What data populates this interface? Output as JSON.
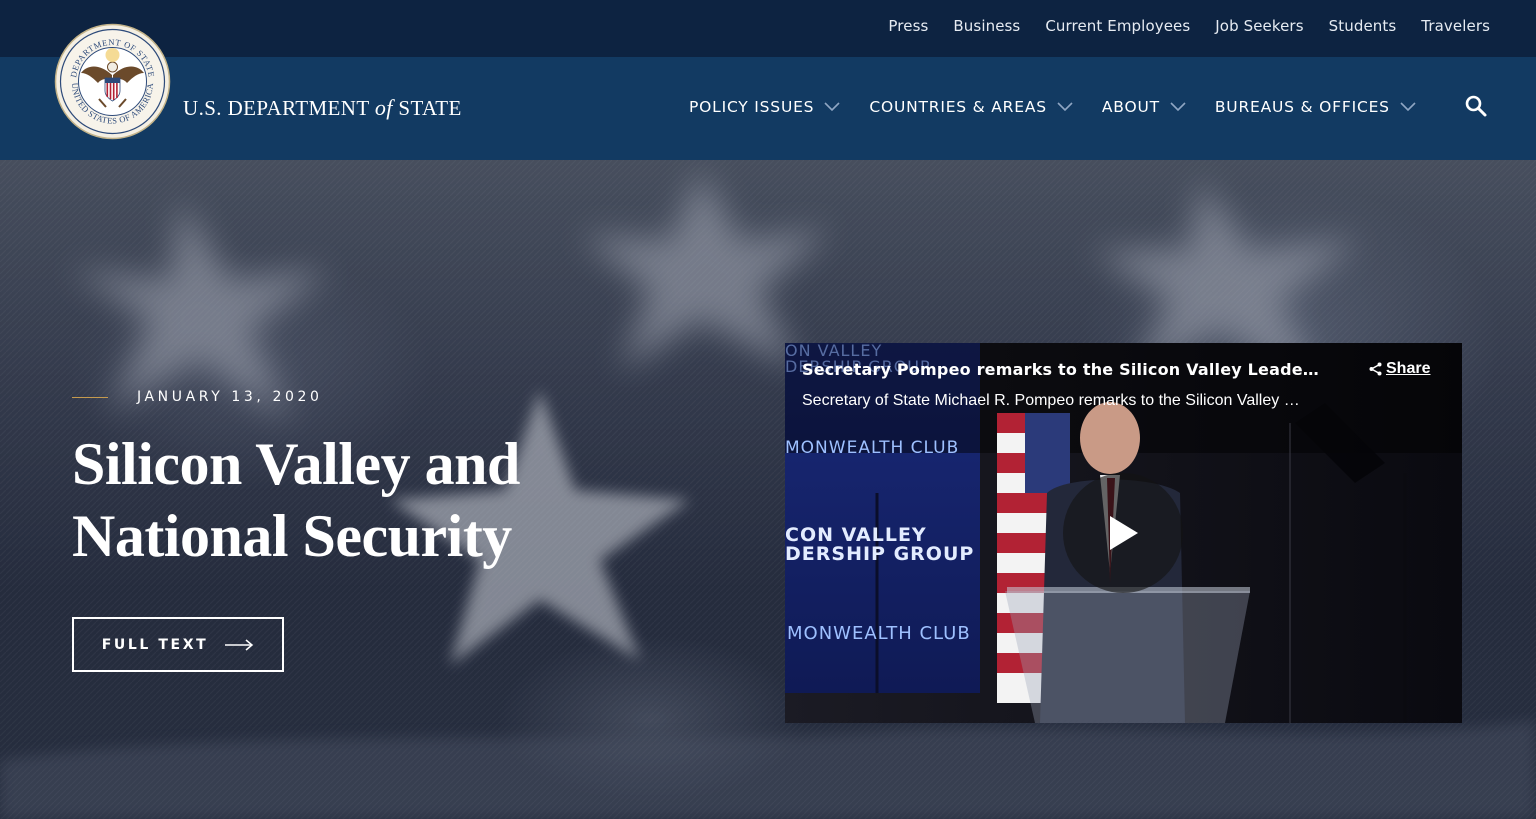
{
  "utility_nav": {
    "links": [
      "Press",
      "Business",
      "Current Employees",
      "Job Seekers",
      "Students",
      "Travelers"
    ]
  },
  "header": {
    "brand_prefix": "U.S. DEPARTMENT ",
    "brand_of": "of",
    "brand_suffix": " STATE",
    "seal_text_top": "DEPARTMENT OF STATE",
    "seal_text_bottom": "UNITED STATES OF AMERICA",
    "nav": [
      {
        "label": "POLICY ISSUES"
      },
      {
        "label": "COUNTRIES & AREAS"
      },
      {
        "label": "ABOUT"
      },
      {
        "label": "BUREAUS & OFFICES"
      }
    ]
  },
  "hero": {
    "date": "JANUARY 13, 2020",
    "headline_line1": "Silicon Valley and",
    "headline_line2": "National Security",
    "cta_label": "FULL TEXT"
  },
  "video": {
    "title": "Secretary Pompeo remarks to the Silicon Valley Leadership Group",
    "description": "Secretary of State Michael R. Pompeo remarks to the Silicon Valley Leadership Group",
    "share_label": "Share",
    "sign_texts": [
      "ON VALLEY",
      "DERSHIP GROUP",
      "MONWEALTH CLUB",
      "CON VALLEY",
      "DERSHIP GROUP",
      "MONWEALTH CLUB"
    ]
  },
  "colors": {
    "utility_bg": "#0d2341",
    "header_bg": "#123a62",
    "accent_gold": "#c59a4e"
  },
  "icons": [
    "seal-icon",
    "chevron-down-icon",
    "search-icon",
    "arrow-right-icon",
    "share-icon",
    "play-icon"
  ]
}
